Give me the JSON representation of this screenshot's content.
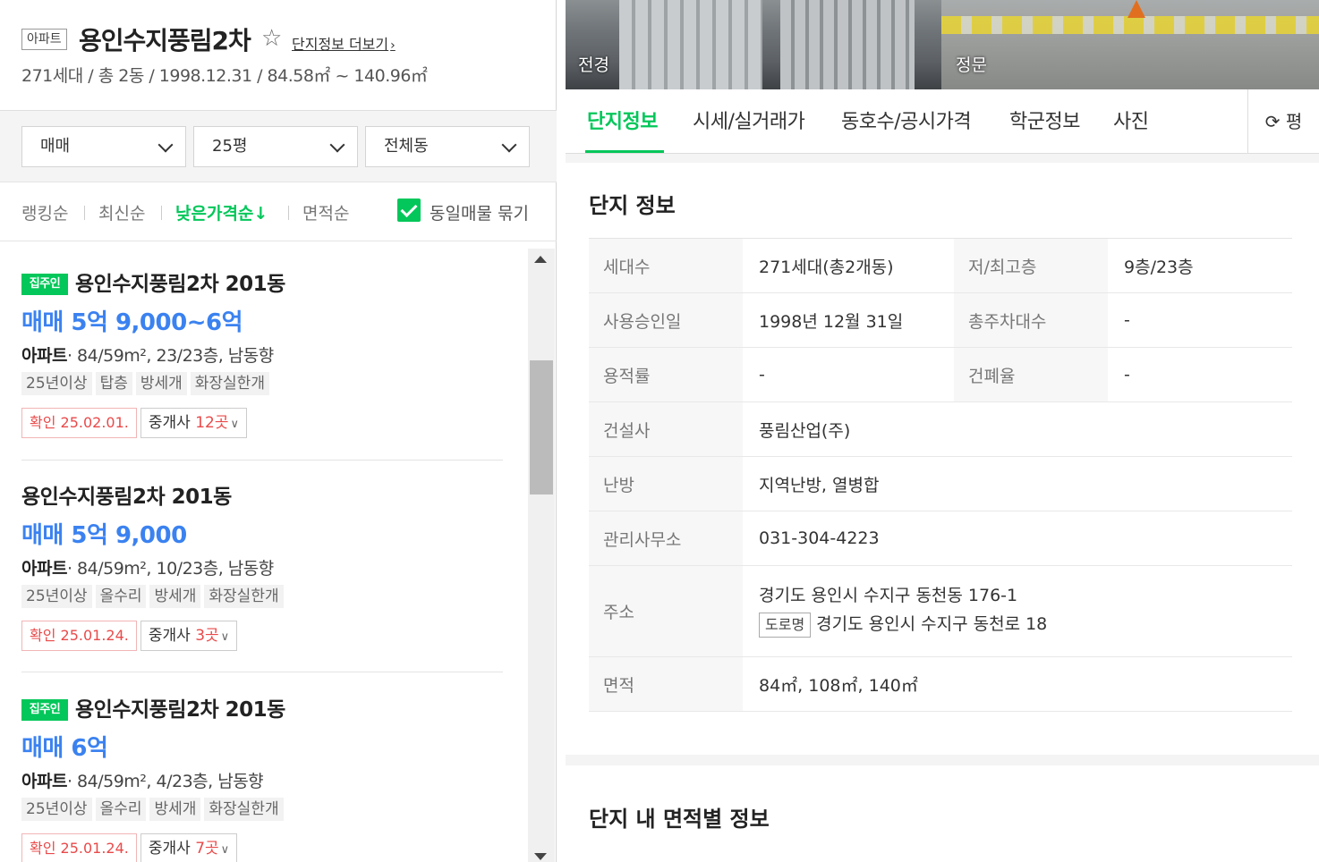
{
  "complex": {
    "type_badge": "아파트",
    "title": "용인수지풍림2차",
    "more_link": "단지정보 더보기",
    "summary": "271세대 / 총 2동 / 1998.12.31 / 84.58㎡ ~ 140.96㎡"
  },
  "filters": {
    "trade": "매매",
    "size": "25평",
    "dong": "전체동"
  },
  "sorts": {
    "ranking": "랭킹순",
    "latest": "최신순",
    "low_price": "낮은가격순↓",
    "area": "면적순",
    "group_label": "동일매물 묶기"
  },
  "listings": [
    {
      "owner_badge": "집주인",
      "title": "용인수지풍림2차 201동",
      "price": "매매 5억 9,000~6억",
      "type": "아파트",
      "spec": "· 84/59m², 23/23층, 남동향",
      "tags": [
        "25년이상",
        "탑층",
        "방세개",
        "화장실한개"
      ],
      "confirm": "확인 25.02.01.",
      "agents_label": "중개사",
      "agents_count": "12곳"
    },
    {
      "owner_badge": "",
      "title": "용인수지풍림2차 201동",
      "price": "매매 5억 9,000",
      "type": "아파트",
      "spec": "· 84/59m², 10/23층, 남동향",
      "tags": [
        "25년이상",
        "올수리",
        "방세개",
        "화장실한개"
      ],
      "confirm": "확인 25.01.24.",
      "agents_label": "중개사",
      "agents_count": "3곳"
    },
    {
      "owner_badge": "집주인",
      "title": "용인수지풍림2차 201동",
      "price": "매매 6억",
      "type": "아파트",
      "spec": "· 84/59m², 4/23층, 남동향",
      "tags": [
        "25년이상",
        "올수리",
        "방세개",
        "화장실한개"
      ],
      "confirm": "확인 25.01.24.",
      "agents_label": "중개사",
      "agents_count": "7곳"
    }
  ],
  "photos": {
    "left_label": "전경",
    "right_label": "정문"
  },
  "tabs": [
    "단지정보",
    "시세/실거래가",
    "동호수/공시가격",
    "학군정보",
    "사진"
  ],
  "tab_right": "평",
  "info_card": {
    "title": "단지 정보",
    "households_label": "세대수",
    "households_value": "271세대(총2개동)",
    "floors_label": "저/최고층",
    "floors_value": "9층/23층",
    "approval_label": "사용승인일",
    "approval_value": "1998년 12월 31일",
    "parking_label": "총주차대수",
    "parking_value": "-",
    "far_label": "용적률",
    "far_value": "-",
    "bcr_label": "건폐율",
    "bcr_value": "-",
    "builder_label": "건설사",
    "builder_value": "풍림산업(주)",
    "heating_label": "난방",
    "heating_value": "지역난방, 열병합",
    "office_label": "관리사무소",
    "office_value": "031-304-4223",
    "address_label": "주소",
    "address_lot": "경기도 용인시 수지구 동천동 176-1",
    "road_badge": "도로명",
    "address_road": "경기도 용인시 수지구 동천로 18",
    "area_label": "면적",
    "area_value": "84㎡, 108㎡, 140㎡"
  },
  "area_card": {
    "title": "단지 내 면적별 정보"
  },
  "colors": {
    "accent": "#03c75a",
    "price": "#3b82f0",
    "alert": "#e94a4a"
  }
}
